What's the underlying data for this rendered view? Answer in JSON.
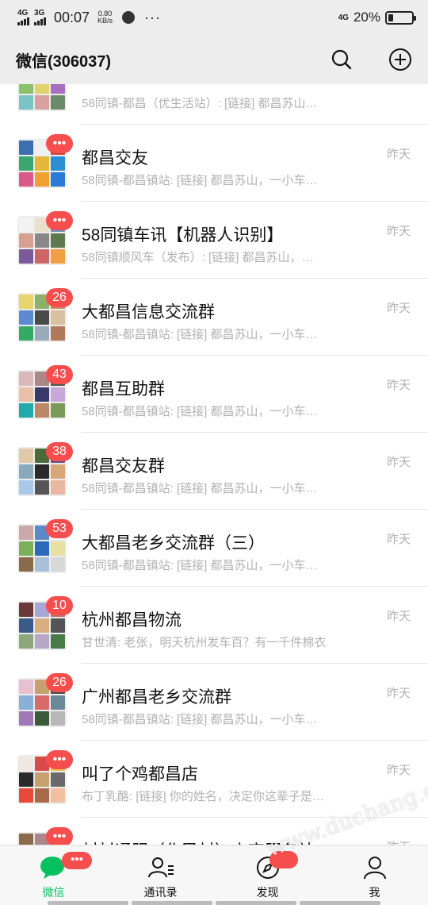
{
  "status_bar": {
    "net1": "4G",
    "net2": "3G",
    "time": "00:07",
    "speed_value": "0.80",
    "speed_unit": "KB/s",
    "dots": "···",
    "net_right": "4G",
    "battery": "20%",
    "battery_level": 0.2
  },
  "header": {
    "title": "微信(306037)",
    "search_icon": "search-icon",
    "add_icon": "plus-circle-icon"
  },
  "chats": [
    {
      "title": "",
      "preview": "58同镇-都昌（优生活站）: [链接] 都昌苏山…",
      "time": "",
      "badge": "",
      "colors": [
        "#c8a86a",
        "#6f9bd1",
        "#d96b6b",
        "#8bbf6a",
        "#e0d36a",
        "#a66fbf",
        "#7cc3c3",
        "#d9a0a0",
        "#6a8a6a"
      ]
    },
    {
      "title": "都昌交友",
      "preview": "58同镇-都昌镇站: [链接] 都昌苏山，一小车…",
      "time": "昨天",
      "badge": "•••",
      "colors": [
        "#3b6fb0",
        "#f0f0f0",
        "#c44",
        "#3aa76d",
        "#e6b83a",
        "#2c8fd6",
        "#d85a8a",
        "#f0a030",
        "#2a7ad8"
      ]
    },
    {
      "title": "58同镇车讯【机器人识别】",
      "preview": "58同镇顺风车（发布）: [链接] 都昌苏山，…",
      "time": "昨天",
      "badge": "•••",
      "colors": [
        "#f2f2f2",
        "#e8e0c8",
        "#6a8fb8",
        "#d8a090",
        "#888",
        "#5d7a4e",
        "#7a5a9a",
        "#c66",
        "#f0a040"
      ]
    },
    {
      "title": "大都昌信息交流群",
      "preview": "58同镇-都昌镇站: [链接] 都昌苏山，一小车…",
      "time": "昨天",
      "badge": "26",
      "colors": [
        "#e8d46a",
        "#8ab06a",
        "#c86",
        "#5a8ad0",
        "#4a4a4a",
        "#d8c0a0",
        "#3a6",
        "#9ab",
        "#b07a5a"
      ]
    },
    {
      "title": "都昌互助群",
      "preview": "58同镇-都昌镇站: [链接] 都昌苏山，一小车…",
      "time": "昨天",
      "badge": "43",
      "colors": [
        "#d8b8b8",
        "#a88",
        "#555",
        "#e8c0a8",
        "#3a3a6a",
        "#c8a8d8",
        "#2aa",
        "#b86",
        "#7a9a5a"
      ]
    },
    {
      "title": "都昌交友群",
      "preview": "58同镇-都昌镇站: [链接] 都昌苏山，一小车…",
      "time": "昨天",
      "badge": "38",
      "colors": [
        "#e0c8a8",
        "#4a6a3a",
        "#6a4a8a",
        "#8ab",
        "#2a2a2a",
        "#d8a878",
        "#a8c8e8",
        "#555",
        "#e8b8a0"
      ]
    },
    {
      "title": "大都昌老乡交流群（三）",
      "preview": "58同镇-都昌镇站: [链接] 都昌苏山，一小车…",
      "time": "昨天",
      "badge": "53",
      "colors": [
        "#c8a8a8",
        "#5a8ac8",
        "#f0f0f0",
        "#7ab05a",
        "#2a6ab8",
        "#e8e0a0",
        "#8a6a4a",
        "#a8c0d8",
        "#d8d8d8"
      ]
    },
    {
      "title": "杭州都昌物流",
      "preview": "甘世清: 老张，明天杭州发车百？有一千件棉衣",
      "time": "昨天",
      "badge": "10",
      "colors": [
        "#6a3a3a",
        "#a8a8d8",
        "#c86a6a",
        "#3a5a8a",
        "#d8b080",
        "#555",
        "#8aa87a",
        "#b8a8c8",
        "#4a7a4a"
      ]
    },
    {
      "title": "广州都昌老乡交流群",
      "preview": "58同镇-都昌镇站: [链接] 都昌苏山，一小车…",
      "time": "昨天",
      "badge": "26",
      "colors": [
        "#e8c0d0",
        "#c8a070",
        "#4a4a4a",
        "#8ab0d8",
        "#d86a6a",
        "#6a8a9a",
        "#a078b8",
        "#3a5a3a",
        "#b8b8b8"
      ]
    },
    {
      "title": "叫了个鸡都昌店",
      "preview": "布丁乳酪: [链接] 你的姓名，决定你这辈子是…",
      "time": "昨天",
      "badge": "•••",
      "colors": [
        "#f0e8e0",
        "#d84a4a",
        "#e8c04a",
        "#2a2a2a",
        "#c8a070",
        "#6a6a6a",
        "#e84a3a",
        "#a86a4a",
        "#f0c0a0"
      ]
    },
    {
      "title": "村村通服（化民村）电商服务站",
      "preview": "",
      "time": "昨天",
      "badge": "•••",
      "colors": [
        "#8a6a4a",
        "#a88",
        "#555",
        "#e0c0a0",
        "#7a7a7a",
        "#b8a070",
        "#555",
        "#a0a0a0",
        "#c8b090"
      ]
    }
  ],
  "tabbar": {
    "tabs": [
      {
        "label": "微信",
        "icon": "chat-bubble-icon",
        "badge": "•••"
      },
      {
        "label": "通讯录",
        "icon": "contacts-icon"
      },
      {
        "label": "发现",
        "icon": "compass-icon"
      },
      {
        "label": "我",
        "icon": "person-icon"
      }
    ]
  },
  "watermark": "www.duchang.org",
  "colors": {
    "accent": "#07c160",
    "badge": "#f64d4d",
    "background": "#ededed"
  }
}
